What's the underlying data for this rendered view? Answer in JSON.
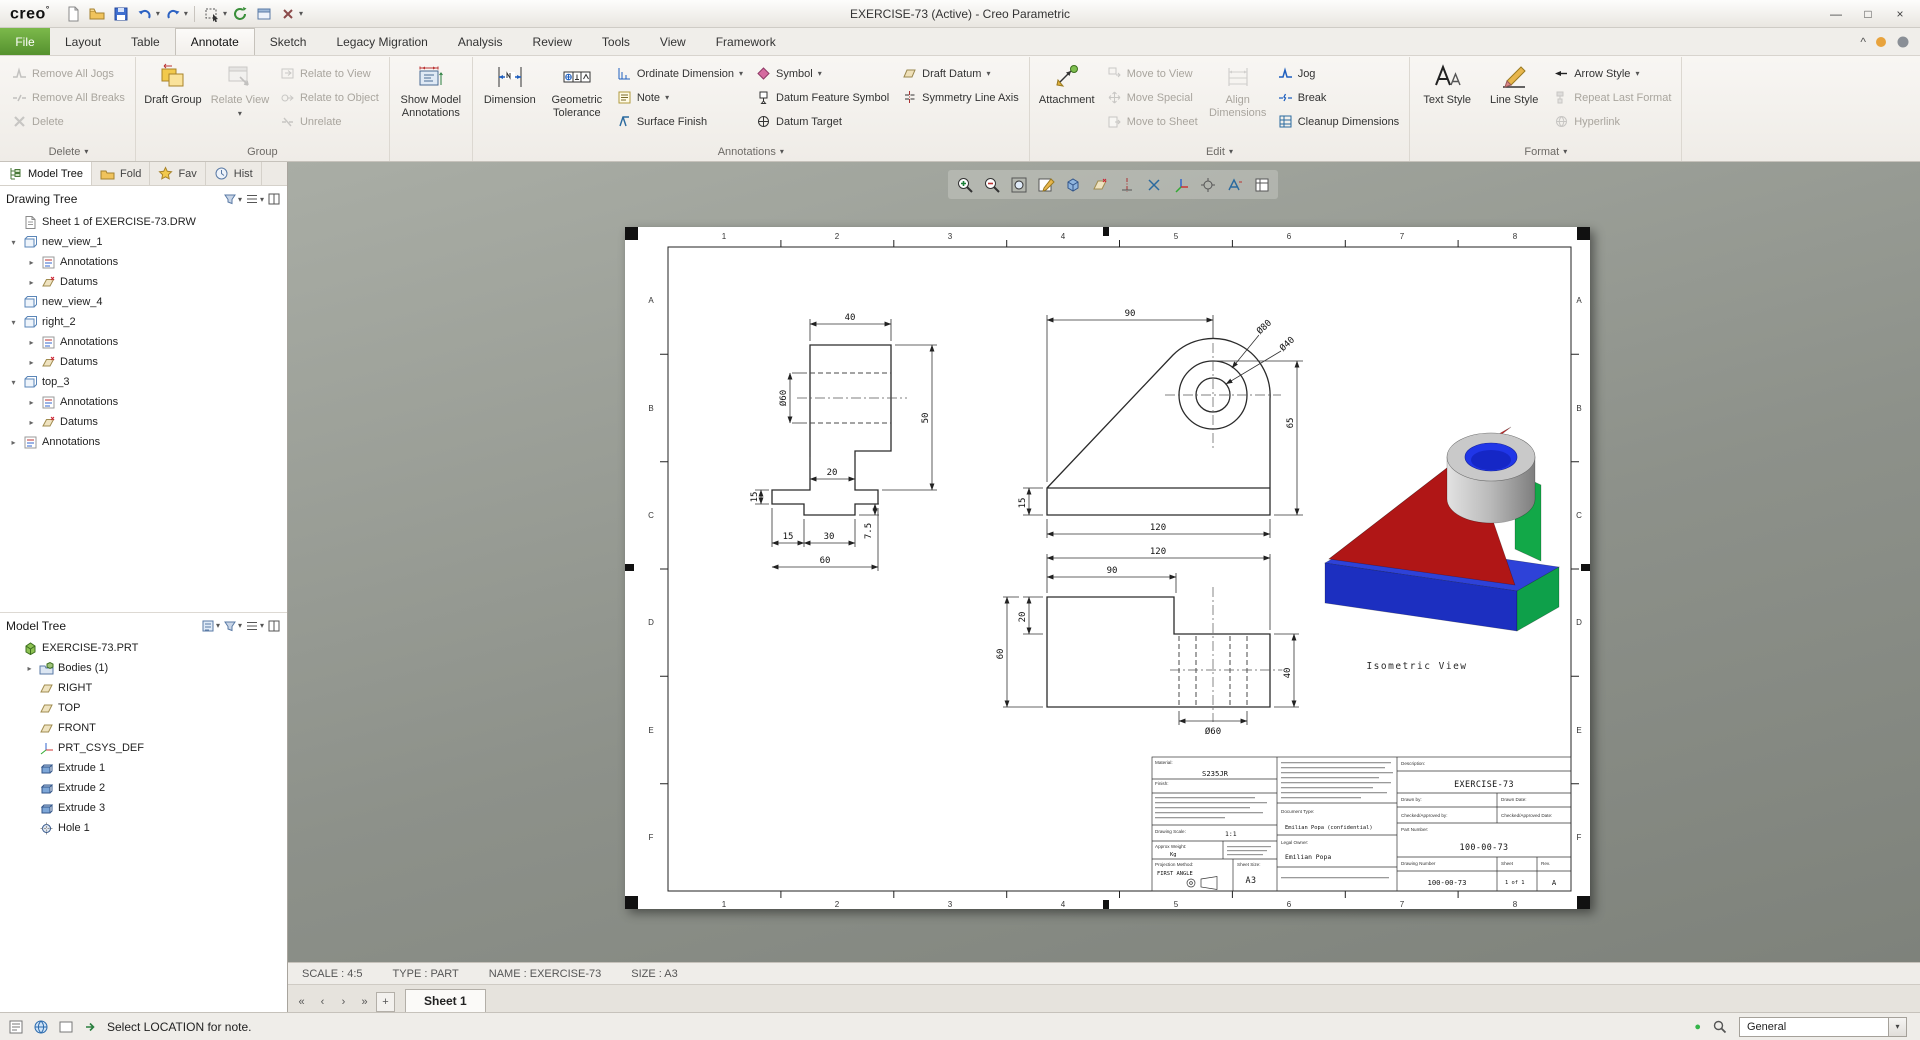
{
  "window": {
    "title": "EXERCISE-73 (Active) - Creo Parametric"
  },
  "glyphs": {
    "caret": "▾",
    "tri_r": "▸",
    "tri_d": "▾",
    "min": "—",
    "max": "□",
    "close": "×",
    "chev_up": "^",
    "nav_first": "«",
    "nav_prev": "‹",
    "nav_next": "›",
    "nav_last": "»",
    "plus": "+",
    "dot": "●",
    "brand": "creo",
    "deg": "°"
  },
  "ribbon_tabs": {
    "file": "File",
    "layout": "Layout",
    "table": "Table",
    "annotate": "Annotate",
    "sketch": "Sketch",
    "legacy": "Legacy Migration",
    "analysis": "Analysis",
    "review": "Review",
    "tools": "Tools",
    "view": "View",
    "framework": "Framework"
  },
  "ribbon": {
    "delete": {
      "label": "Delete",
      "remove_all_jogs": "Remove All Jogs",
      "remove_all_breaks": "Remove All Breaks",
      "delete_btn": "Delete"
    },
    "group": {
      "label": "Group",
      "draft_group": "Draft Group",
      "relate_view": "Relate View",
      "relate_to_view": "Relate to View",
      "relate_to_object": "Relate to Object",
      "unrelate": "Unrelate"
    },
    "sma_group_label": "",
    "show_model_annotations": "Show Model Annotations",
    "annotations": {
      "label": "Annotations",
      "dimension": "Dimension",
      "geometric_tolerance": "Geometric Tolerance",
      "ordinate_dimension": "Ordinate Dimension",
      "note": "Note",
      "surface_finish": "Surface Finish",
      "symbol": "Symbol",
      "datum_feature_symbol": "Datum Feature Symbol",
      "datum_target": "Datum Target",
      "draft_datum": "Draft Datum",
      "symmetry_line_axis": "Symmetry Line Axis"
    },
    "edit": {
      "label": "Edit",
      "attachment": "Attachment",
      "move_to_view": "Move to View",
      "move_special": "Move Special",
      "move_to_sheet": "Move to Sheet",
      "align_dimensions": "Align Dimensions",
      "jog": "Jog",
      "break_btn": "Break",
      "cleanup_dimensions": "Cleanup Dimensions"
    },
    "format": {
      "label": "Format",
      "text_style": "Text Style",
      "line_style": "Line Style",
      "arrow_style": "Arrow Style",
      "repeat_last_format": "Repeat Last Format",
      "hyperlink": "Hyperlink"
    }
  },
  "navigator": {
    "tabs": {
      "model_tree": "Model Tree",
      "folder": "Fold",
      "favorites": "Fav",
      "history": "Hist"
    },
    "drawing_tree": {
      "title": "Drawing Tree",
      "items": [
        {
          "label": "Sheet 1 of EXERCISE-73.DRW"
        },
        {
          "label": "new_view_1"
        },
        {
          "label": "Annotations"
        },
        {
          "label": "Datums"
        },
        {
          "label": "new_view_4"
        },
        {
          "label": "right_2"
        },
        {
          "label": "Annotations"
        },
        {
          "label": "Datums"
        },
        {
          "label": "top_3"
        },
        {
          "label": "Annotations"
        },
        {
          "label": "Datums"
        },
        {
          "label": "Annotations"
        }
      ]
    },
    "model_tree": {
      "title": "Model Tree",
      "items": [
        {
          "label": "EXERCISE-73.PRT"
        },
        {
          "label": "Bodies (1)"
        },
        {
          "label": "RIGHT"
        },
        {
          "label": "TOP"
        },
        {
          "label": "FRONT"
        },
        {
          "label": "PRT_CSYS_DEF"
        },
        {
          "label": "Extrude 1"
        },
        {
          "label": "Extrude 2"
        },
        {
          "label": "Extrude 3"
        },
        {
          "label": "Hole 1"
        }
      ]
    }
  },
  "drawing": {
    "zones_letters": [
      "A",
      "B",
      "C",
      "D",
      "E",
      "F"
    ],
    "zones_numbers": [
      "1",
      "2",
      "3",
      "4",
      "5",
      "6",
      "7",
      "8"
    ],
    "front": {
      "d40": "40",
      "d60": "Ø60",
      "d50": "50",
      "d20": "20",
      "d15a": "15",
      "d15b": "15",
      "d30": "30",
      "d60b": "60",
      "d75": "7.5"
    },
    "side": {
      "d90": "90",
      "d80": "Ø80",
      "d40": "Ø40",
      "d65": "65",
      "d15": "15",
      "d120": "120"
    },
    "top": {
      "d120": "120",
      "d90": "90",
      "d20": "20",
      "d60": "60",
      "d40": "40",
      "d60h": "Ø60"
    },
    "iso_label": "Isometric View",
    "titleblock": {
      "material_label": "Material:",
      "material": "S235JR",
      "finish_label": "Finish:",
      "scale_label": "Drawing Scale:",
      "scale": "1:1",
      "weight_label": "Approx Weight:",
      "weight_unit": "Kg",
      "projection_label": "Projection Method:",
      "projection": "FIRST ANGLE",
      "sheet_size_label": "Sheet Size:",
      "sheet_size": "A3",
      "doc_type_label": "Document Type:",
      "confidential": "Emilian Popa (confidential)",
      "legal_owner_label": "Legal Owner:",
      "owner": "Emilian Popa",
      "description_label": "Description:",
      "description": "EXERCISE-73",
      "drawn_by_label": "Drawn by:",
      "drawn_date_label": "Drawn Date:",
      "checked_label": "Checked/Approved by:",
      "checked_date_label": "Checked/Approved Date:",
      "part_number_label": "Part Number:",
      "part_number": "100-00-73",
      "drawing_number_label": "Drawing Number",
      "drawing_number": "100-00-73",
      "sheet_label": "Sheet",
      "sheet": "1 of 1",
      "revision_label": "Rev.",
      "revision": "A"
    }
  },
  "status": {
    "scale": "SCALE : 4:5",
    "type": "TYPE : PART",
    "name": "NAME : EXERCISE-73",
    "size": "SIZE : A3"
  },
  "sheets": {
    "active": "Sheet 1"
  },
  "bottom": {
    "message": "Select LOCATION for note.",
    "filter": "General"
  }
}
